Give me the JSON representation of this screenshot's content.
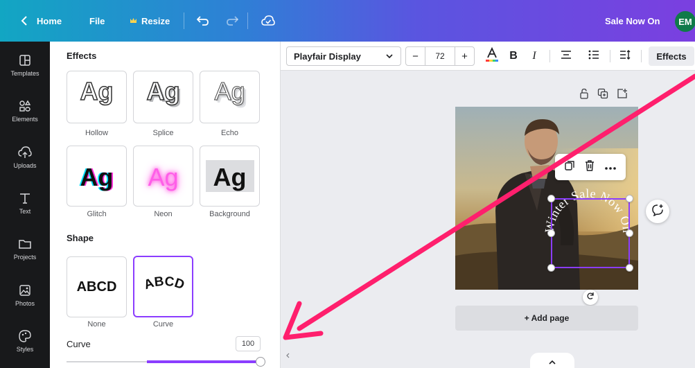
{
  "topbar": {
    "back_icon": "chevron-left-icon",
    "home_label": "Home",
    "file_label": "File",
    "resize_icon": "crown-icon",
    "resize_label": "Resize",
    "undo_icon": "undo-icon",
    "redo_icon": "redo-icon",
    "cloud_icon": "cloud-check-icon",
    "design_title": "Sale Now On",
    "avatar_initials": "EM"
  },
  "rail": {
    "items": [
      {
        "label": "Templates",
        "icon": "templates-icon"
      },
      {
        "label": "Elements",
        "icon": "elements-icon"
      },
      {
        "label": "Uploads",
        "icon": "upload-cloud-icon"
      },
      {
        "label": "Text",
        "icon": "text-icon"
      },
      {
        "label": "Projects",
        "icon": "folder-icon"
      },
      {
        "label": "Photos",
        "icon": "image-icon"
      },
      {
        "label": "Styles",
        "icon": "palette-icon"
      }
    ]
  },
  "panel": {
    "title": "Effects",
    "style_effects": [
      {
        "label": "Hollow",
        "preview": "Ag"
      },
      {
        "label": "Splice",
        "preview": "Ag"
      },
      {
        "label": "Echo",
        "preview": "Ag"
      },
      {
        "label": "Glitch",
        "preview": "Ag"
      },
      {
        "label": "Neon",
        "preview": "Ag"
      },
      {
        "label": "Background",
        "preview": "Ag"
      }
    ],
    "shape_title": "Shape",
    "shapes": [
      {
        "label": "None",
        "preview": "ABCD",
        "selected": false
      },
      {
        "label": "Curve",
        "preview": "ABCD",
        "selected": true
      }
    ],
    "curve_label": "Curve",
    "curve_value": "100",
    "curve_slider_fraction": 1.0
  },
  "text_toolbar": {
    "font_family": "Playfair Display",
    "decrease_label": "−",
    "font_size": "72",
    "increase_label": "+",
    "text_color_icon": "text-color-icon",
    "bold_label": "B",
    "italic_label": "I",
    "align_icon": "align-center-icon",
    "list_icon": "list-icon",
    "spacing_icon": "spacing-icon",
    "effects_label": "Effects"
  },
  "canvas": {
    "curved_text": "Winter Sale Now On",
    "add_page_label": "+ Add page",
    "page_tool_icons": [
      "lock-icon",
      "duplicate-icon",
      "add-page-icon"
    ],
    "float_menu_icons": [
      "copy-icon",
      "trash-icon",
      "more-icon"
    ]
  },
  "colors": {
    "accent": "#8b3dff",
    "annotation_arrow": "#ff1f6d",
    "rail_bg": "#18191b",
    "topbar_start": "#12a6c3",
    "topbar_end": "#7b3fe0"
  }
}
